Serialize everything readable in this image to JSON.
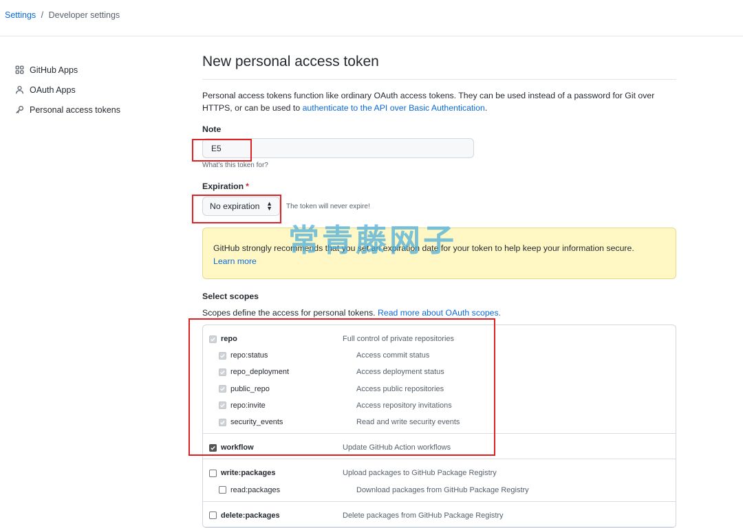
{
  "breadcrumb": {
    "settings": "Settings",
    "separator": "/",
    "current": "Developer settings"
  },
  "sidebar": {
    "items": [
      {
        "label": "GitHub Apps",
        "icon": "apps-grid-icon"
      },
      {
        "label": "OAuth Apps",
        "icon": "person-icon"
      },
      {
        "label": "Personal access tokens",
        "icon": "key-icon"
      }
    ]
  },
  "main": {
    "title": "New personal access token",
    "intro_text": "Personal access tokens function like ordinary OAuth access tokens. They can be used instead of a password for Git over HTTPS, or can be used to ",
    "intro_link": "authenticate to the API over Basic Authentication",
    "intro_end": ".",
    "note": {
      "label": "Note",
      "value": "E5",
      "hint": "What's this token for?"
    },
    "expiration": {
      "label": "Expiration",
      "required_mark": "*",
      "selected": "No expiration",
      "message": "The token will never expire!"
    },
    "flash": {
      "text": "GitHub strongly recommends that you set an expiration date for your token to help keep your information secure.",
      "link": "Learn more",
      "watermark": "常青藤网子"
    },
    "scopes": {
      "title": "Select scopes",
      "desc_text": "Scopes define the access for personal tokens. ",
      "desc_link": "Read more about OAuth scopes.",
      "groups": [
        {
          "parent": {
            "name": "repo",
            "desc": "Full control of private repositories",
            "state": "checked-disabled"
          },
          "children": [
            {
              "name": "repo:status",
              "desc": "Access commit status",
              "state": "checked-disabled"
            },
            {
              "name": "repo_deployment",
              "desc": "Access deployment status",
              "state": "checked-disabled"
            },
            {
              "name": "public_repo",
              "desc": "Access public repositories",
              "state": "checked-disabled"
            },
            {
              "name": "repo:invite",
              "desc": "Access repository invitations",
              "state": "checked-disabled"
            },
            {
              "name": "security_events",
              "desc": "Read and write security events",
              "state": "checked-disabled"
            }
          ]
        },
        {
          "parent": {
            "name": "workflow",
            "desc": "Update GitHub Action workflows",
            "state": "checked"
          },
          "children": []
        },
        {
          "parent": {
            "name": "write:packages",
            "desc": "Upload packages to GitHub Package Registry",
            "state": "unchecked"
          },
          "children": [
            {
              "name": "read:packages",
              "desc": "Download packages from GitHub Package Registry",
              "state": "unchecked"
            }
          ]
        },
        {
          "parent": {
            "name": "delete:packages",
            "desc": "Delete packages from GitHub Package Registry",
            "state": "unchecked"
          },
          "children": []
        }
      ]
    }
  },
  "colors": {
    "link": "#0969da",
    "highlight_box": "#e02020",
    "flash_bg": "#fff8c5",
    "required": "#cf222e"
  }
}
